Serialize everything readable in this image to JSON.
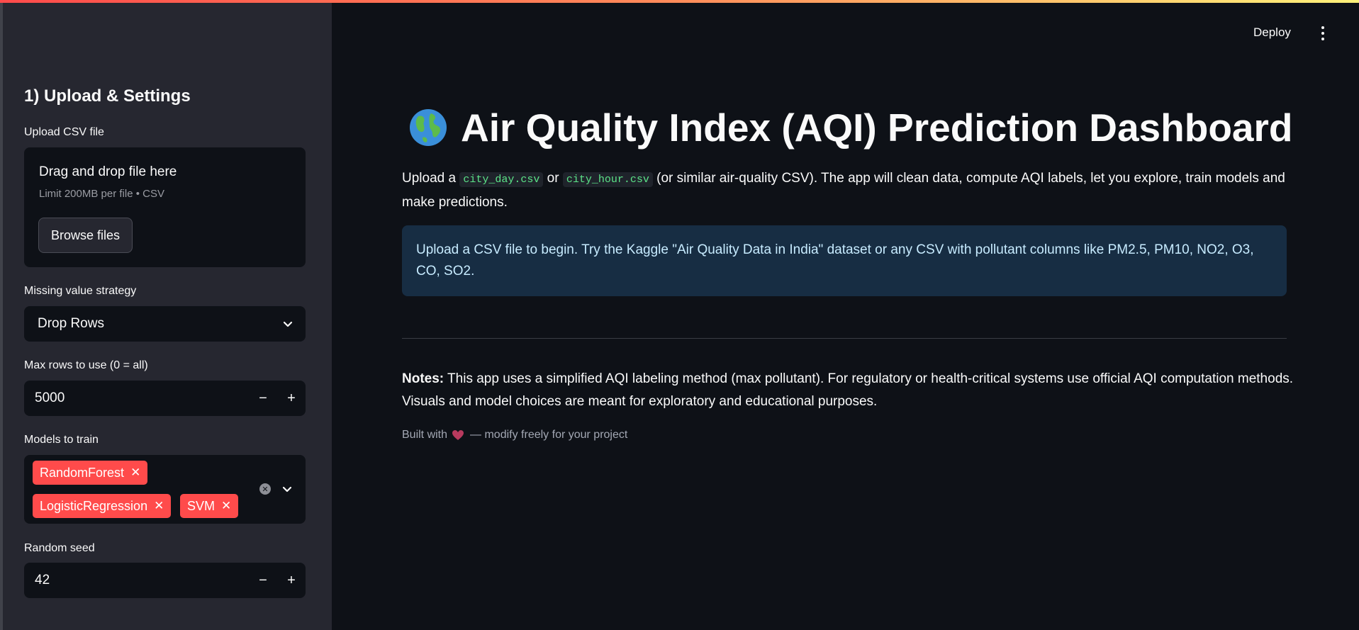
{
  "header": {
    "deploy_label": "Deploy",
    "menu_icon": "kebab-menu-icon"
  },
  "sidebar": {
    "heading": "1) Upload & Settings",
    "upload": {
      "label": "Upload CSV file",
      "drop_title": "Drag and drop file here",
      "limit_text": "Limit 200MB per file • CSV",
      "browse_label": "Browse files"
    },
    "missing_strategy": {
      "label": "Missing value strategy",
      "selected": "Drop Rows"
    },
    "max_rows": {
      "label": "Max rows to use (0 = all)",
      "value": "5000"
    },
    "models": {
      "label": "Models to train",
      "selected": [
        "RandomForest",
        "LogisticRegression",
        "SVM"
      ]
    },
    "random_seed": {
      "label": "Random seed",
      "value": "42"
    },
    "stepper": {
      "minus": "−",
      "plus": "+"
    }
  },
  "main": {
    "title_icon": "globe-emoji",
    "title": "Air Quality Index (AQI) Prediction Dashboard",
    "intro": {
      "before": "Upload a ",
      "code1": "city_day.csv",
      "mid": " or ",
      "code2": "city_hour.csv",
      "after": " (or similar air-quality CSV). The app will clean data, compute AQI labels, let you explore, train models and make predictions."
    },
    "info": "Upload a CSV file to begin. Try the Kaggle \"Air Quality Data in India\" dataset or any CSV with pollutant columns like PM2.5, PM10, NO2, O3, CO, SO2.",
    "notes": {
      "label": "Notes:",
      "text": " This app uses a simplified AQI labeling method (max pollutant). For regulatory or health-critical systems use official AQI computation methods. Visuals and model choices are meant for exploratory and educational purposes."
    },
    "footer": {
      "before": "Built with",
      "after": "— modify freely for your project"
    }
  },
  "colors": {
    "accent": "#ff4b4b",
    "background": "#0e1117",
    "sidebar": "#262730",
    "info_bg": "#172d43",
    "code_text": "#5ce488"
  }
}
